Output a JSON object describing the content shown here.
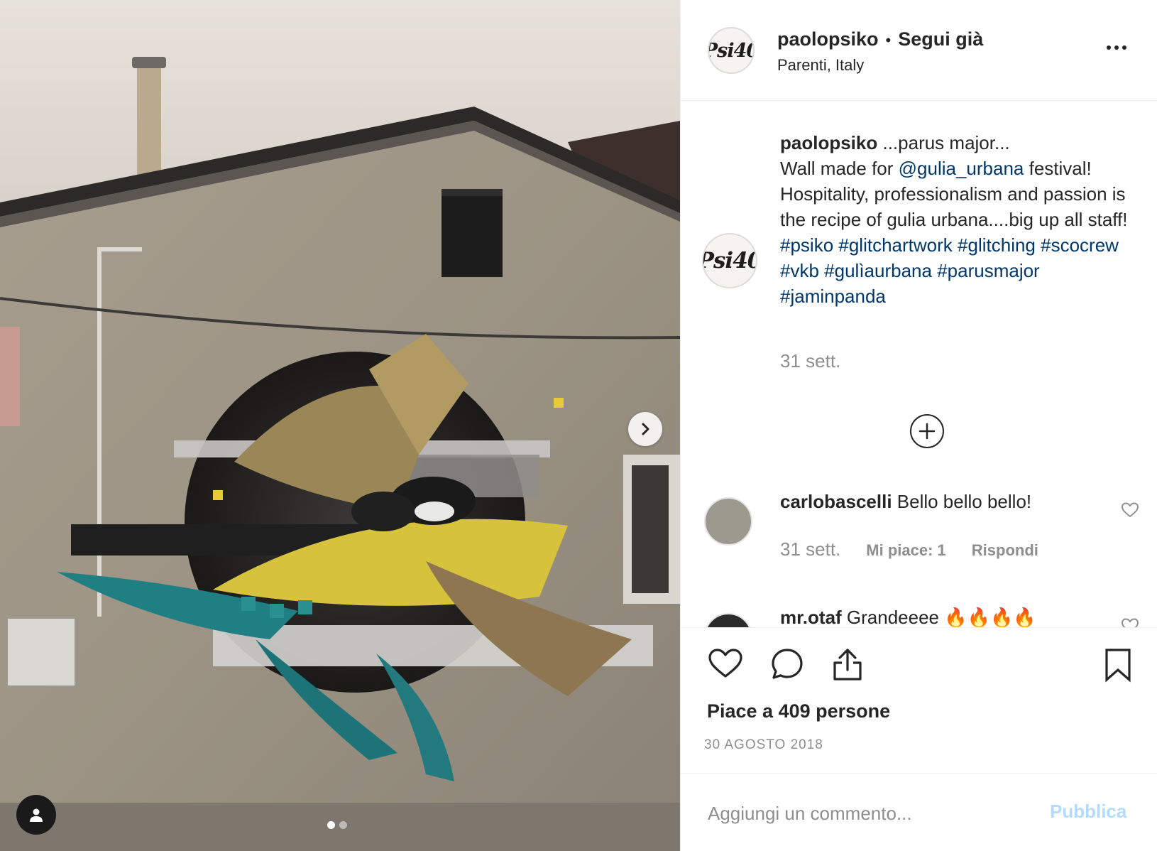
{
  "post": {
    "username": "paolopsiko",
    "follow_separator": "•",
    "follow_status": "Segui già",
    "location": "Parenti, Italy",
    "avatar_logo": "Psi40"
  },
  "caption": {
    "username": "paolopsiko",
    "line1": " ...parus major...",
    "line2_pre": "Wall made for ",
    "mention": "@gulia_urbana",
    "line2_post": " festival!",
    "body": "Hospitality, professionalism and passion is the recipe of gulia urbana....big up all staff!",
    "hashtags": [
      "#psiko",
      "#glitchartwork",
      "#glitching",
      "#scocrew",
      "#vkb",
      "#gulìaurbana",
      "#parusmajor",
      "#jaminpanda"
    ],
    "time": "31 sett."
  },
  "comments": [
    {
      "username": "carlobascelli",
      "text": " Bello bello bello!",
      "time": "31 sett.",
      "likes": "Mi piace: 1",
      "reply": "Rispondi"
    },
    {
      "username": "mr.otaf",
      "text": " Grandeeee 🔥🔥🔥🔥"
    }
  ],
  "actions": {
    "like_icon": "heart-icon",
    "comment_icon": "comment-icon",
    "share_icon": "share-icon",
    "save_icon": "bookmark-icon"
  },
  "likes_text": "Piace a 409 persone",
  "date": "30 AGOSTO 2018",
  "add_comment": {
    "placeholder": "Aggiungi un commento...",
    "publish": "Pubblica"
  },
  "carousel": {
    "index": 1,
    "total": 2
  },
  "colors": {
    "link": "#00376b",
    "muted": "#8e8e8e",
    "publish_disabled": "#b3dbff",
    "text": "#262626"
  }
}
